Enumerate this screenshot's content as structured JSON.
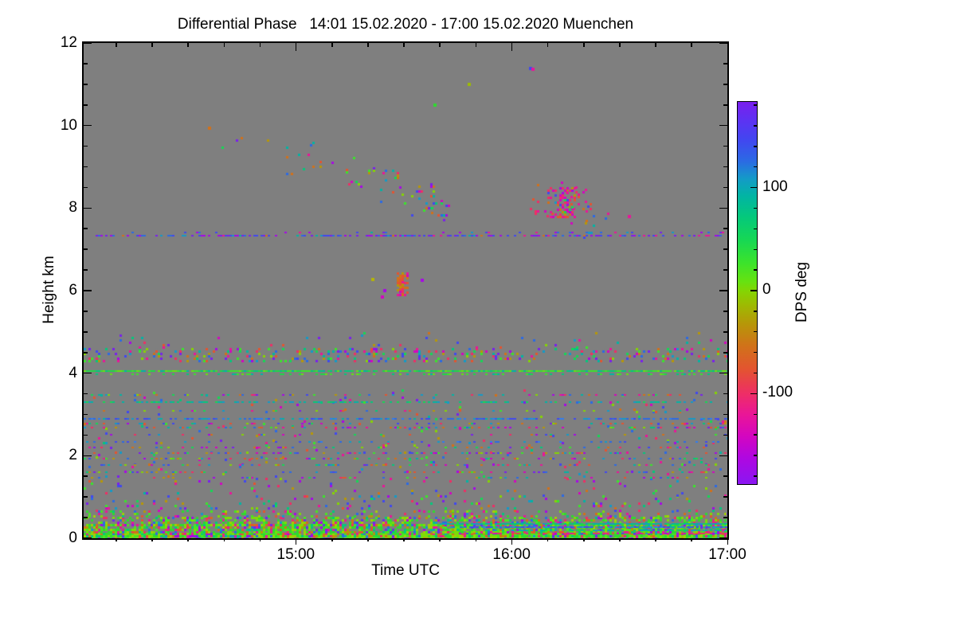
{
  "chart_data": {
    "type": "heatmap",
    "title": "Differential Phase   14:01 15.02.2020 - 17:00 15.02.2020 Muenchen",
    "xlabel": "Time UTC",
    "ylabel": "Height km",
    "station": "Muenchen",
    "date": "15.02.2020",
    "time_start": "14:01",
    "time_end": "17:00",
    "t_range": [
      1,
      180
    ],
    "x_ticks": [
      {
        "t": 60,
        "label": "15:00"
      },
      {
        "t": 120,
        "label": "16:00"
      },
      {
        "t": 180,
        "label": "17:00"
      }
    ],
    "x_minor_step_minutes": 10,
    "ylim": [
      0,
      12
    ],
    "y_ticks": [
      0,
      2,
      4,
      6,
      8,
      10,
      12
    ],
    "y_minor_step_km": 0.5,
    "nodata_color": "#7f7f7f",
    "colorbar": {
      "label": "DPS deg",
      "ticks": [
        100,
        0,
        -100
      ],
      "minor_step": 20,
      "minor_range": [
        -180,
        180
      ],
      "frac_at_zero": 0.4937,
      "frac_per_deg": 0.002695,
      "gradient": [
        [
          0.0,
          "#7a1fee"
        ],
        [
          0.05,
          "#5c33f2"
        ],
        [
          0.1,
          "#4147f0"
        ],
        [
          0.155,
          "#2b6ae4"
        ],
        [
          0.2,
          "#149ac8"
        ],
        [
          0.245,
          "#02b4a4"
        ],
        [
          0.3,
          "#04c87c"
        ],
        [
          0.36,
          "#16d755"
        ],
        [
          0.42,
          "#3be32c"
        ],
        [
          0.47,
          "#66e211"
        ],
        [
          0.496,
          "#85d403"
        ],
        [
          0.53,
          "#9dbb02"
        ],
        [
          0.58,
          "#b69708"
        ],
        [
          0.64,
          "#d1711a"
        ],
        [
          0.7,
          "#e35430"
        ],
        [
          0.74,
          "#ea3b52"
        ],
        [
          0.763,
          "#ee2e66"
        ],
        [
          0.82,
          "#e91599"
        ],
        [
          0.875,
          "#d306c0"
        ],
        [
          0.93,
          "#b007e0"
        ],
        [
          1.0,
          "#8a16f2"
        ]
      ]
    },
    "palettes": {
      "mixed": [
        [
          "#ee2e66",
          1
        ],
        [
          "#e91599",
          1
        ],
        [
          "#d306c0",
          1
        ],
        [
          "#a808e6",
          1
        ],
        [
          "#7a1fee",
          1
        ],
        [
          "#4147f0",
          1.2
        ],
        [
          "#2b6ae4",
          1.2
        ],
        [
          "#149ac8",
          1
        ],
        [
          "#02b4a4",
          1
        ],
        [
          "#04c87c",
          1
        ],
        [
          "#16d755",
          1
        ],
        [
          "#3be32c",
          1
        ],
        [
          "#85d403",
          1
        ],
        [
          "#b69708",
          1
        ],
        [
          "#d1711a",
          1
        ],
        [
          "#e35430",
          1
        ]
      ],
      "surface": [
        [
          "#2fd92f",
          5
        ],
        [
          "#4ae520",
          4
        ],
        [
          "#7ddc06",
          3
        ],
        [
          "#a3cf02",
          2
        ],
        [
          "#e91599",
          1.2
        ],
        [
          "#a808e6",
          1
        ],
        [
          "#6a2bee",
          0.8
        ],
        [
          "#2b6ae4",
          0.8
        ],
        [
          "#149ac8",
          0.6
        ],
        [
          "#d1711a",
          1
        ],
        [
          "#e35430",
          0.8
        ],
        [
          "#ee2e66",
          0.8
        ],
        [
          "#04c87c",
          1.5
        ],
        [
          "#b69708",
          0.8
        ]
      ],
      "green": [
        [
          "#1fd747",
          3
        ],
        [
          "#3be32c",
          3
        ],
        [
          "#04c87c",
          2
        ],
        [
          "#66e211",
          2
        ],
        [
          "#02b4a4",
          1
        ]
      ],
      "blue": [
        [
          "#2b6ae4",
          3
        ],
        [
          "#4147f0",
          2
        ],
        [
          "#149ac8",
          2
        ],
        [
          "#2f7df0",
          2
        ],
        [
          "#02b4a4",
          0.5
        ]
      ],
      "cyan": [
        [
          "#02b4a4",
          3
        ],
        [
          "#04c87c",
          2
        ],
        [
          "#149ac8",
          2
        ],
        [
          "#16d755",
          1
        ]
      ],
      "blueviolet": [
        [
          "#4147f0",
          3
        ],
        [
          "#7a1fee",
          2
        ],
        [
          "#2b6ae4",
          2
        ],
        [
          "#a808e6",
          2
        ],
        [
          "#149ac8",
          1
        ],
        [
          "#e91599",
          1
        ],
        [
          "#d1711a",
          0.5
        ],
        [
          "#02b4a4",
          0.7
        ]
      ],
      "hot": [
        [
          "#e35430",
          3
        ],
        [
          "#d1711a",
          2.5
        ],
        [
          "#ee2e66",
          2
        ],
        [
          "#e91599",
          1.5
        ],
        [
          "#b69708",
          1
        ],
        [
          "#d306c0",
          0.7
        ]
      ],
      "pinkmix": [
        [
          "#ee2e66",
          3
        ],
        [
          "#e91599",
          2.5
        ],
        [
          "#d306c0",
          1.5
        ],
        [
          "#e35430",
          1.2
        ],
        [
          "#d1711a",
          1
        ],
        [
          "#4147f0",
          0.8
        ],
        [
          "#a808e6",
          0.8
        ],
        [
          "#16d755",
          0.6
        ],
        [
          "#b69708",
          0.6
        ],
        [
          "#149ac8",
          0.5
        ]
      ]
    },
    "features": [
      {
        "kind": "band",
        "t": [
          1,
          180
        ],
        "h": [
          0.0,
          0.14
        ],
        "density": 0.97,
        "palette": "surface"
      },
      {
        "kind": "band",
        "t": [
          1,
          180
        ],
        "h": [
          0.14,
          0.34
        ],
        "density": 0.7,
        "palette": "surface"
      },
      {
        "kind": "band",
        "t": [
          1,
          180
        ],
        "h": [
          0.34,
          0.52
        ],
        "density": 0.42,
        "palette": "surface"
      },
      {
        "kind": "band",
        "t": [
          1,
          180
        ],
        "h": [
          0.52,
          0.68
        ],
        "density": 0.16,
        "palette": "surface"
      },
      {
        "kind": "band",
        "t": [
          1,
          180
        ],
        "h": [
          0.68,
          1.05
        ],
        "density": 0.07,
        "palette": "mixed"
      },
      {
        "kind": "band",
        "t": [
          1,
          180
        ],
        "h": [
          1.05,
          1.4
        ],
        "density": 0.04,
        "palette": "mixed"
      },
      {
        "kind": "band",
        "t": [
          1,
          180
        ],
        "h": [
          1.4,
          3.6
        ],
        "density": 0.022,
        "palette": "mixed"
      },
      {
        "kind": "row",
        "t": [
          1,
          180
        ],
        "h": 1.48,
        "density": 0.16,
        "palette": "mixed"
      },
      {
        "kind": "row",
        "t": [
          1,
          180
        ],
        "h": 1.63,
        "density": 0.2,
        "palette": "mixed"
      },
      {
        "kind": "row",
        "t": [
          1,
          180
        ],
        "h": 1.8,
        "density": 0.28,
        "palette": "mixed"
      },
      {
        "kind": "row",
        "t": [
          1,
          180
        ],
        "h": 1.95,
        "density": 0.24,
        "palette": "mixed"
      },
      {
        "kind": "row",
        "t": [
          1,
          180
        ],
        "h": 2.08,
        "density": 0.28,
        "palette": "mixed"
      },
      {
        "kind": "row",
        "t": [
          1,
          180
        ],
        "h": 2.22,
        "density": 0.18,
        "palette": "mixed"
      },
      {
        "kind": "row",
        "t": [
          1,
          180
        ],
        "h": 2.35,
        "density": 0.13,
        "palette": "blue"
      },
      {
        "kind": "row",
        "t": [
          1,
          180
        ],
        "h": 2.52,
        "density": 0.1,
        "palette": "mixed"
      },
      {
        "kind": "row",
        "t": [
          1,
          180
        ],
        "h": 2.7,
        "density": 0.26,
        "palette": "mixed"
      },
      {
        "kind": "row",
        "t": [
          1,
          180
        ],
        "h": 2.8,
        "density": 0.18,
        "palette": "mixed"
      },
      {
        "kind": "row",
        "t": [
          1,
          180
        ],
        "h": 2.92,
        "density": 0.6,
        "palette": "blue"
      },
      {
        "kind": "row",
        "t": [
          1,
          180
        ],
        "h": 3.1,
        "density": 0.1,
        "palette": "mixed"
      },
      {
        "kind": "row",
        "t": [
          1,
          180
        ],
        "h": 3.32,
        "density": 0.4,
        "palette": "cyan"
      },
      {
        "kind": "row",
        "t": [
          1,
          180
        ],
        "h": 3.5,
        "density": 0.2,
        "palette": "mixed"
      },
      {
        "kind": "band",
        "t": [
          1,
          180
        ],
        "h": [
          4.3,
          4.62
        ],
        "density": 0.2,
        "palette": "mixed"
      },
      {
        "kind": "row",
        "t": [
          1,
          180
        ],
        "h": 4.07,
        "density": 0.92,
        "palette": "green"
      },
      {
        "kind": "row",
        "t": [
          1,
          180
        ],
        "h": 4.0,
        "density": 0.3,
        "palette": "green"
      },
      {
        "kind": "band",
        "t": [
          1,
          180
        ],
        "h": [
          4.62,
          5.0
        ],
        "density": 0.018,
        "palette": "mixed"
      },
      {
        "kind": "row",
        "t": [
          1,
          180
        ],
        "h": 7.35,
        "density": 0.55,
        "palette": "blueviolet"
      },
      {
        "kind": "row",
        "t": [
          1,
          180
        ],
        "h": 7.43,
        "density": 0.12,
        "palette": "blueviolet"
      },
      {
        "kind": "row",
        "t": [
          100,
          180
        ],
        "h": 0.36,
        "density": 0.85,
        "palette": "cyan"
      },
      {
        "kind": "row",
        "t": [
          103,
          180
        ],
        "h": 0.29,
        "density": 0.8,
        "palette": "blue"
      },
      {
        "kind": "row",
        "t": [
          112,
          180
        ],
        "h": 0.21,
        "density": 0.55,
        "palette": "cyan"
      },
      {
        "kind": "row",
        "t": [
          100,
          180
        ],
        "h": 0.13,
        "density": 0.4,
        "palette": "pinkmix"
      },
      {
        "kind": "band",
        "t": [
          32,
          56
        ],
        "h": [
          9.2,
          9.9
        ],
        "density": 0.012,
        "palette": "mixed"
      },
      {
        "kind": "band",
        "t": [
          56,
          70
        ],
        "h": [
          8.8,
          9.6
        ],
        "density": 0.035,
        "palette": "mixed"
      },
      {
        "kind": "band",
        "t": [
          70,
          80
        ],
        "h": [
          8.5,
          9.3
        ],
        "density": 0.05,
        "palette": "mixed"
      },
      {
        "kind": "band",
        "t": [
          80,
          90
        ],
        "h": [
          8.1,
          9.0
        ],
        "density": 0.07,
        "palette": "mixed"
      },
      {
        "kind": "band",
        "t": [
          90,
          100
        ],
        "h": [
          7.8,
          8.6
        ],
        "density": 0.1,
        "palette": "mixed"
      },
      {
        "kind": "band",
        "t": [
          97,
          104
        ],
        "h": [
          7.6,
          8.2
        ],
        "density": 0.09,
        "palette": "mixed"
      },
      {
        "kind": "band",
        "t": [
          88,
          91
        ],
        "h": [
          5.9,
          6.45
        ],
        "density": 0.6,
        "palette": "hot"
      },
      {
        "kind": "band",
        "t": [
          88.8,
          90.2
        ],
        "h": [
          6.0,
          6.35
        ],
        "density": 0.9,
        "palette": "hot"
      },
      {
        "kind": "band",
        "t": [
          125,
          143
        ],
        "h": [
          7.6,
          8.7
        ],
        "density": 0.09,
        "palette": "pinkmix"
      },
      {
        "kind": "band",
        "t": [
          130,
          138
        ],
        "h": [
          7.8,
          8.5
        ],
        "density": 0.38,
        "palette": "pinkmix"
      },
      {
        "kind": "band",
        "t": [
          140,
          147
        ],
        "h": [
          7.3,
          7.95
        ],
        "density": 0.05,
        "palette": "mixed"
      },
      {
        "kind": "singles",
        "points": [
          {
            "t": 125.2,
            "h": 11.38,
            "color": "#4147f0"
          },
          {
            "t": 125.9,
            "h": 11.36,
            "color": "#e91599"
          },
          {
            "t": 108.3,
            "h": 11.0,
            "color": "#9dbb02"
          },
          {
            "t": 98.6,
            "h": 10.5,
            "color": "#2fd92f"
          },
          {
            "t": 81.5,
            "h": 6.27,
            "color": "#b6b602"
          },
          {
            "t": 84.8,
            "h": 6.0,
            "color": "#a808e6"
          },
          {
            "t": 95.2,
            "h": 6.25,
            "color": "#a808e6"
          },
          {
            "t": 84.0,
            "h": 5.85,
            "color": "#d306c0"
          },
          {
            "t": 152.7,
            "h": 7.8,
            "color": "#e91599"
          },
          {
            "t": 36.0,
            "h": 9.93,
            "color": "#d1711a"
          }
        ]
      }
    ]
  }
}
